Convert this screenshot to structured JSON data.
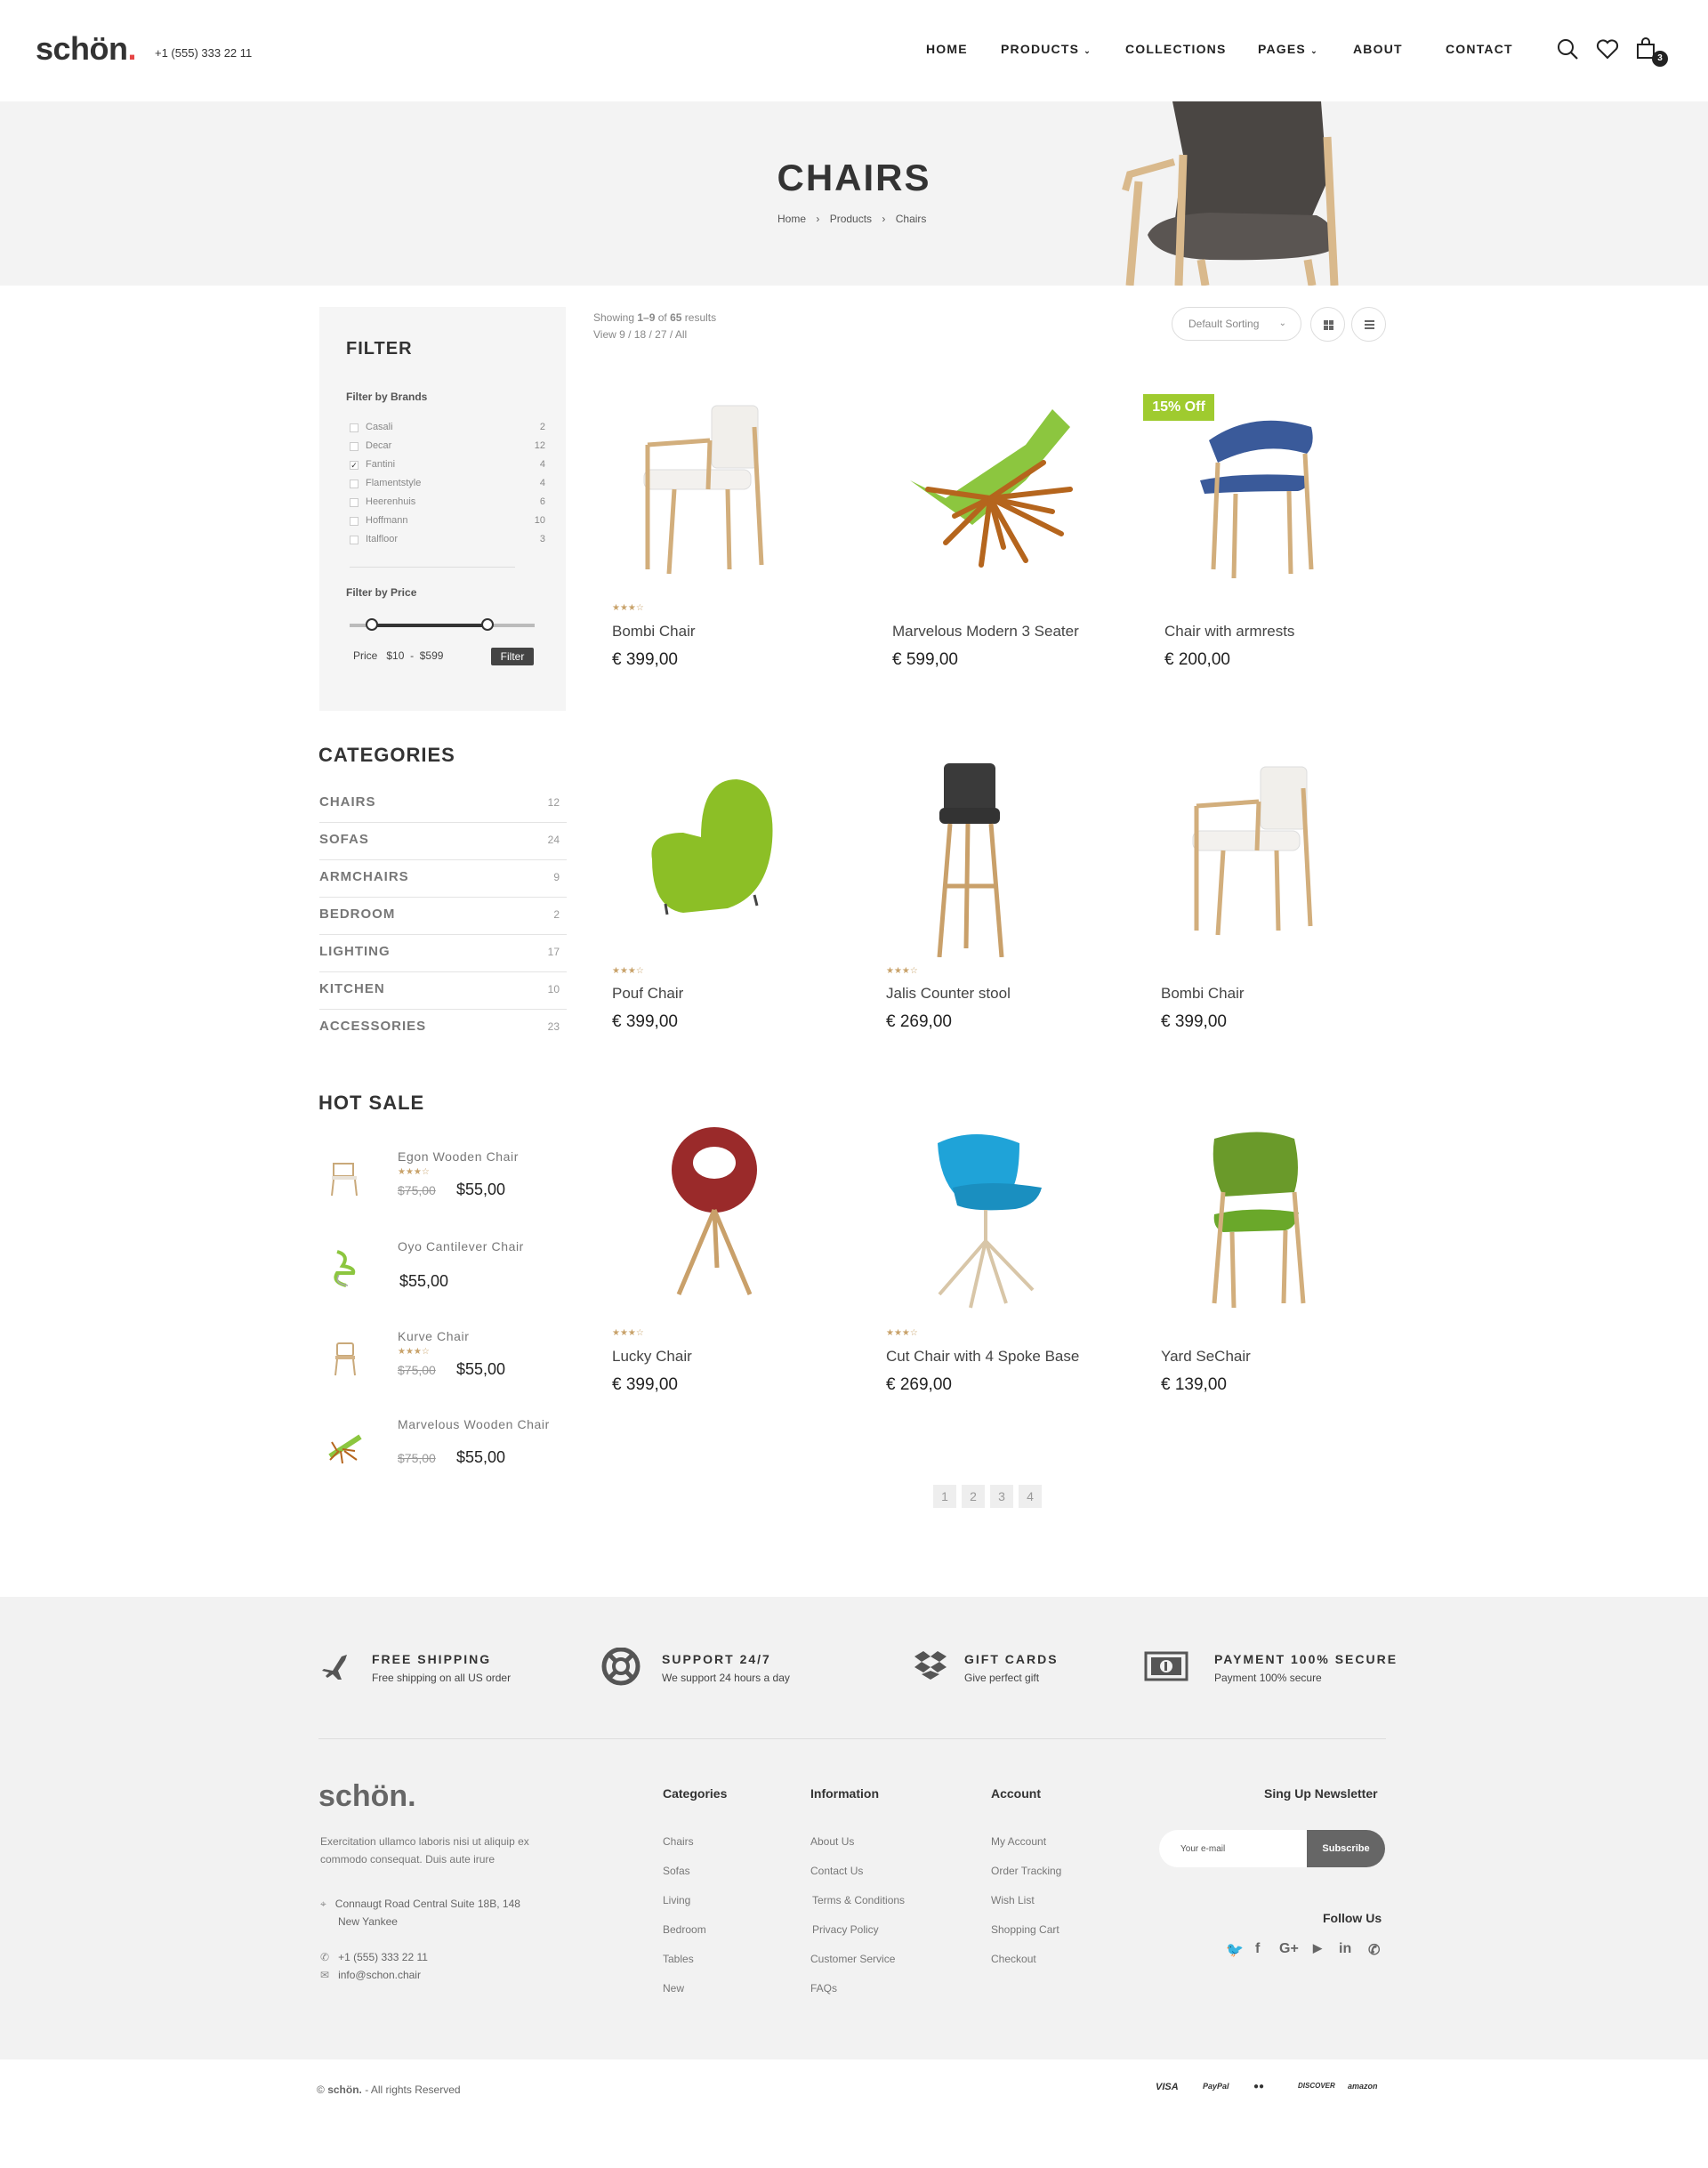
{
  "header": {
    "logo": "schön",
    "logo_dot": ".",
    "phone": "+1 (555) 333 22 11",
    "nav": [
      {
        "label": "HOME",
        "has_dropdown": false
      },
      {
        "label": "PRODUCTS",
        "has_dropdown": true
      },
      {
        "label": "COLLECTIONS",
        "has_dropdown": false
      },
      {
        "label": "PAGES",
        "has_dropdown": true
      },
      {
        "label": "ABOUT",
        "has_dropdown": false
      },
      {
        "label": "CONTACT",
        "has_dropdown": false
      }
    ],
    "icons": [
      "search-icon",
      "heart-icon",
      "shopping-bag-icon"
    ],
    "cart_count": "3"
  },
  "banner": {
    "title": "CHAIRS",
    "breadcrumb": [
      "Home",
      "Products",
      "Chairs"
    ]
  },
  "filter": {
    "title": "FILTER",
    "brands_label": "Filter by Brands",
    "brands": [
      {
        "name": "Casali",
        "count": "2",
        "checked": false
      },
      {
        "name": "Decar",
        "count": "12",
        "checked": false
      },
      {
        "name": "Fantini",
        "count": "4",
        "checked": true
      },
      {
        "name": "Flamentstyle",
        "count": "4",
        "checked": false
      },
      {
        "name": "Heerenhuis",
        "count": "6",
        "checked": false
      },
      {
        "name": "Hoffmann",
        "count": "10",
        "checked": false
      },
      {
        "name": "Italfloor",
        "count": "3",
        "checked": false
      }
    ],
    "price_label": "Filter by Price",
    "price_prefix": "Price",
    "price_min": "$10",
    "price_sep": "-",
    "price_max": "$599",
    "button": "Filter"
  },
  "categories": {
    "title": "CATEGORIES",
    "items": [
      {
        "name": "CHAIRS",
        "count": "12"
      },
      {
        "name": "SOFAS",
        "count": "24"
      },
      {
        "name": "ARMCHAIRS",
        "count": "9"
      },
      {
        "name": "BEDROOM",
        "count": "2"
      },
      {
        "name": "LIGHTING",
        "count": "17"
      },
      {
        "name": "KITCHEN",
        "count": "10"
      },
      {
        "name": "ACCESSORIES",
        "count": "23"
      }
    ]
  },
  "hot_sale": {
    "title": "HOT SALE",
    "items": [
      {
        "name": "Egon Wooden Chair",
        "stars": "★★★☆",
        "old_price": "$75,00",
        "price": "$55,00"
      },
      {
        "name": "Oyo Cantilever Chair",
        "stars": "",
        "old_price": "",
        "price": "$55,00"
      },
      {
        "name": "Kurve Chair",
        "stars": "★★★☆",
        "old_price": "$75,00",
        "price": "$55,00"
      },
      {
        "name": "Marvelous Wooden Chair",
        "stars": "",
        "old_price": "$75,00",
        "price": "$55,00"
      }
    ]
  },
  "toolbar": {
    "showing_prefix": "Showing ",
    "showing_range": "1–9",
    "showing_mid": " of ",
    "showing_total": "65",
    "showing_suffix": " results",
    "view": "View  9 / 18 / 27 / All",
    "sort": "Default Sorting"
  },
  "products": [
    {
      "name": "Bombi Chair",
      "price": "€  399,00",
      "stars": "★★★☆"
    },
    {
      "name": "Marvelous Modern 3 Seater",
      "price": "€  599,00",
      "stars": ""
    },
    {
      "name": "Chair with armrests",
      "price": "€  200,00",
      "stars": "",
      "badge": "15% Off"
    },
    {
      "name": "Pouf Chair",
      "price": "€  399,00",
      "stars": "★★★☆"
    },
    {
      "name": "Jalis Counter stool",
      "price": "€  269,00",
      "stars": "★★★☆"
    },
    {
      "name": "Bombi Chair",
      "price": "€  399,00",
      "stars": ""
    },
    {
      "name": "Lucky Chair",
      "price": "€  399,00",
      "stars": "★★★☆"
    },
    {
      "name": "Cut Chair with 4  Spoke Base",
      "price": "€  269,00",
      "stars": "★★★☆"
    },
    {
      "name": "Yard SeChair",
      "price": "€  139,00",
      "stars": ""
    }
  ],
  "pagination": [
    "1",
    "2",
    "3",
    "4"
  ],
  "features": [
    {
      "title": "FREE SHIPPING",
      "desc": "Free shipping on all US order",
      "icon": "airplane-icon"
    },
    {
      "title": "SUPPORT 24/7",
      "desc": "We support 24 hours a day",
      "icon": "lifebuoy-icon"
    },
    {
      "title": "GIFT CARDS",
      "desc": "Give perfect gift",
      "icon": "dropbox-icon"
    },
    {
      "title": "PAYMENT 100% SECURE",
      "desc": "Payment 100% secure",
      "icon": "money-icon"
    }
  ],
  "footer": {
    "logo": "schön.",
    "desc": "Exercitation ullamco laboris nisi ut aliquip ex commodo consequat. Duis aute irure",
    "address_1": "Connaugt Road Central Suite 18B, 148",
    "address_2": "New Yankee",
    "phone": "+1 (555) 333 22 11",
    "email": "info@schon.chair",
    "columns": [
      {
        "title": "Categories",
        "links": [
          "Chairs",
          "Sofas",
          "Living",
          "Bedroom",
          "Tables",
          "New"
        ]
      },
      {
        "title": "Information",
        "links": [
          "About Us",
          "Contact Us",
          "Terms & Conditions",
          "Privacy Policy",
          "Customer Service",
          "FAQs"
        ]
      },
      {
        "title": "Account",
        "links": [
          "My Account",
          "Order Tracking",
          "Wish List",
          "Shopping Cart",
          "Checkout"
        ]
      }
    ],
    "newsletter_title": "Sing Up Newsletter",
    "newsletter_placeholder": "Your e-mail",
    "newsletter_button": "Subscribe",
    "follow": "Follow Us",
    "social": [
      "twitter-icon",
      "facebook-icon",
      "google-plus-icon",
      "youtube-icon",
      "linkedin-icon",
      "whatsapp-icon"
    ],
    "social_glyphs": [
      "🐦",
      "f",
      "G+",
      "▶",
      "in",
      "✆"
    ],
    "copyright_prefix": "© ",
    "copyright_brand": "schön.",
    "copyright_suffix": " - All rights Reserved",
    "payments": [
      "VISA",
      "PayPal",
      "●●",
      "DISCOVER",
      "amazon"
    ]
  },
  "colors": {
    "accent": "#e64545",
    "badge": "#9fcb2f",
    "stars": "#c8a26a",
    "dark": "#333333"
  }
}
